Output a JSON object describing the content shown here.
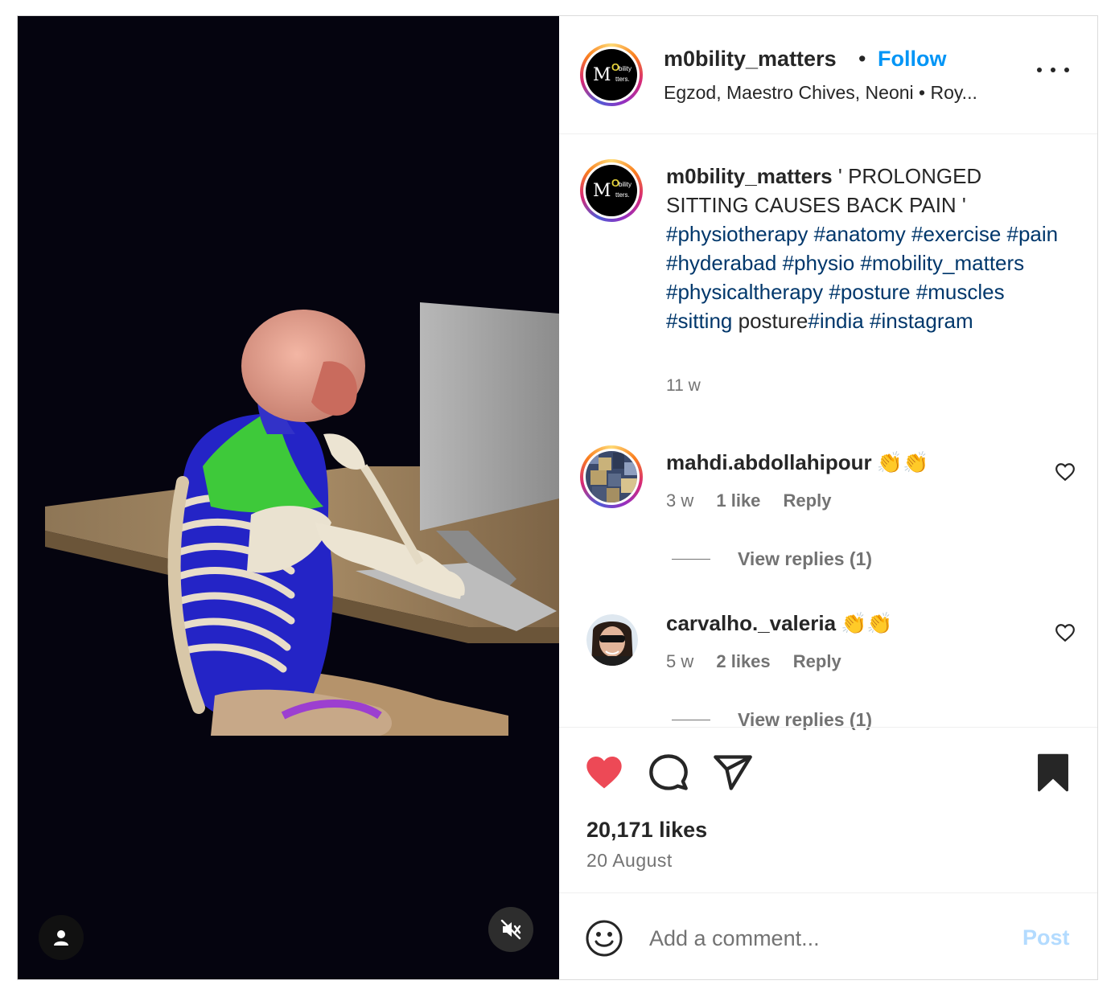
{
  "post": {
    "author": {
      "username": "m0bility_matters",
      "avatar_logo": {
        "m": "M",
        "o": "O",
        "line1": "bility",
        "line2": "tters."
      },
      "follow_label": "Follow",
      "dot": "•",
      "audio_line": "Egzod, Maestro Chives, Neoni • Roy..."
    },
    "caption": {
      "username": "m0bility_matters",
      "text": " ' PROLONGED SITTING CAUSES BACK PAIN ' ",
      "hashtags_a": [
        "#physiotherapy",
        "#anatomy",
        "#exercise",
        "#pain",
        "#hyderabad",
        "#physio",
        "#mobility_matters",
        "#physicaltherapy",
        "#posture",
        "#muscles",
        "#sitting"
      ],
      "plain_word": "posture",
      "hashtags_b": [
        "#india",
        "#instagram"
      ],
      "time": "11 w"
    },
    "comments": [
      {
        "username": "mahdi.abdollahipour",
        "emoji": "👏👏",
        "time": "3 w",
        "likes": "1 like",
        "reply_label": "Reply",
        "view_replies": "View replies (1)"
      },
      {
        "username": "carvalho._valeria",
        "emoji": "👏👏",
        "time": "5 w",
        "likes": "2 likes",
        "reply_label": "Reply",
        "view_replies": "View replies (1)"
      }
    ],
    "actions": {
      "liked": true,
      "saved": true,
      "icons": [
        "heart-icon",
        "comment-icon",
        "share-icon",
        "bookmark-icon"
      ]
    },
    "likes_count": "20,171 likes",
    "date": "20 August",
    "add_comment": {
      "placeholder": "Add a comment...",
      "post_label": "Post"
    },
    "media": {
      "icons": [
        "user-tag-icon",
        "muted-speaker-icon"
      ]
    },
    "colors": {
      "follow": "#0095f6",
      "hashtag": "#00376b",
      "like_red": "#ed4956",
      "post_disabled": "#b3dbff"
    }
  }
}
